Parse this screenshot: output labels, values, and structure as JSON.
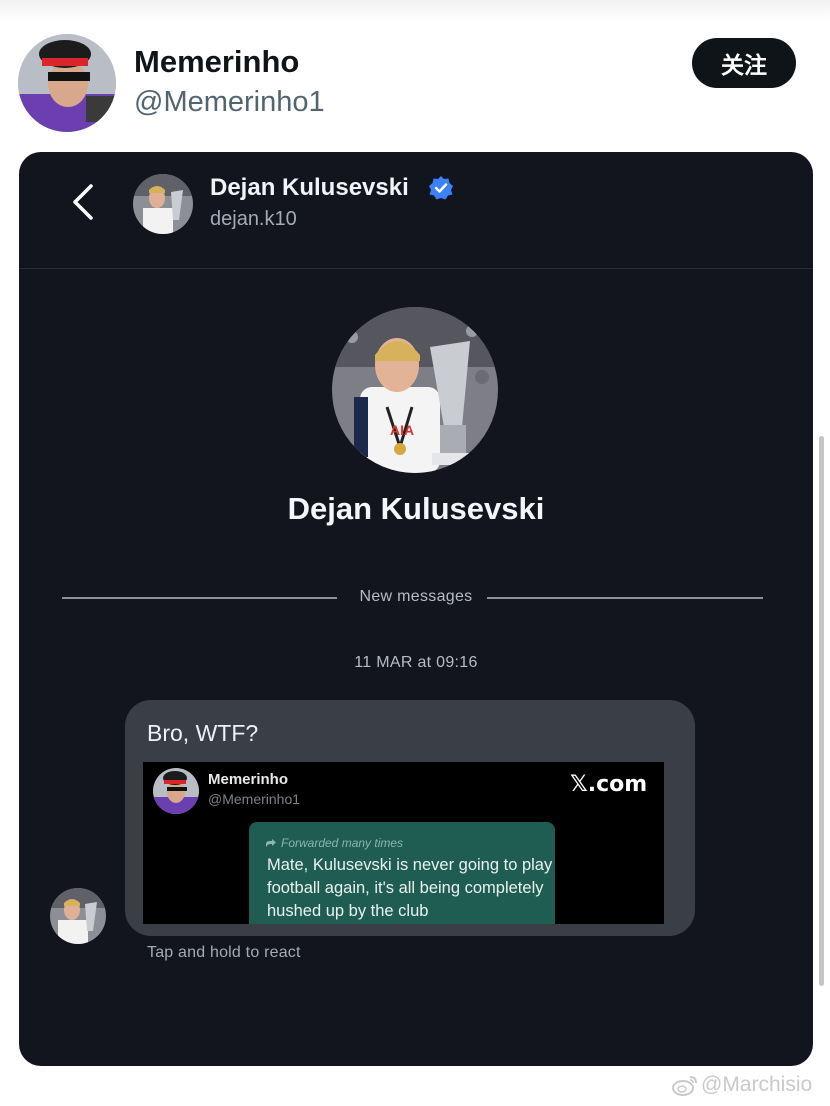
{
  "post": {
    "author_name": "Memerinho",
    "author_handle": "@Memerinho1",
    "follow_label": "关注"
  },
  "dm": {
    "contact_name": "Dejan Kulusevski",
    "contact_handle": "dejan.k10",
    "profile_name": "Dejan Kulusevski",
    "new_messages_label": "New messages",
    "timestamp": "11 MAR at 09:16",
    "message_text": "Bro, WTF?",
    "react_hint": "Tap and hold to react",
    "embedded_card": {
      "author_name": "Memerinho",
      "author_handle": "@Memerinho1",
      "brand": "𝕏.com",
      "forwarded_tag": "Forwarded many times",
      "forwarded_text": "Mate, Kulusevski is never going to play football again, it's all being completely hushed up by the club"
    }
  },
  "watermark": "@Marchisio",
  "colors": {
    "dm_background": "#12151d",
    "bubble": "#3a3e47",
    "forward_bubble": "#1f5c52",
    "verified": "#3b82f6",
    "follow_button": "#0f1419"
  },
  "icons": [
    "back-icon",
    "verified-icon",
    "forward-icon",
    "weibo-icon"
  ]
}
